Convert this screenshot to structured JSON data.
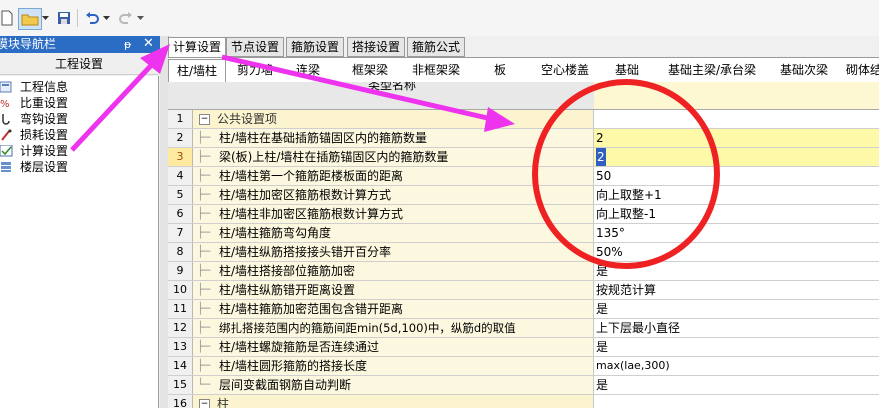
{
  "toolbar": {
    "icons": [
      "new-file-icon",
      "open-folder-icon",
      "dropdown-arrow-icon",
      "save-icon",
      "undo-icon",
      "dropdown-arrow-icon",
      "redo-icon",
      "dropdown-arrow-icon"
    ]
  },
  "nav": {
    "title": "模块导航栏",
    "pin_glyph": "ᵽ",
    "close_glyph": "✕",
    "header": "工程设置",
    "items": [
      {
        "label": "工程信息",
        "icon": "info-icon"
      },
      {
        "label": "比重设置",
        "icon": "ratio-icon"
      },
      {
        "label": "弯钩设置",
        "icon": "hook-icon"
      },
      {
        "label": "损耗设置",
        "icon": "loss-icon"
      },
      {
        "label": "计算设置",
        "icon": "calc-icon"
      },
      {
        "label": "楼层设置",
        "icon": "floor-icon"
      }
    ]
  },
  "tabs": [
    "计算设置",
    "节点设置",
    "箍筋设置",
    "搭接设置",
    "箍筋公式"
  ],
  "subtabs": [
    "柱/墙柱",
    "剪力墙",
    "连梁",
    "框架梁",
    "非框架梁",
    "板",
    "空心楼盖",
    "基础",
    "基础主梁/承台梁",
    "基础次梁",
    "砌体结"
  ],
  "grid": {
    "header_name": "类型名称",
    "rows": [
      {
        "num": "1",
        "name": "公共设置项",
        "value": ""
      },
      {
        "num": "2",
        "name": "柱/墙柱在基础插筋锚固区内的箍筋数量",
        "value": "2"
      },
      {
        "num": "3",
        "name": "梁(板)上柱/墙柱在插筋锚固区内的箍筋数量",
        "value": "2"
      },
      {
        "num": "4",
        "name": "柱/墙柱第一个箍筋距楼板面的距离",
        "value": "50"
      },
      {
        "num": "5",
        "name": "柱/墙柱加密区箍筋根数计算方式",
        "value": "向上取整+1"
      },
      {
        "num": "6",
        "name": "柱/墙柱非加密区箍筋根数计算方式",
        "value": "向上取整-1"
      },
      {
        "num": "7",
        "name": "柱/墙柱箍筋弯勾角度",
        "value": "135°"
      },
      {
        "num": "8",
        "name": "柱/墙柱纵筋搭接接头错开百分率",
        "value": "50%"
      },
      {
        "num": "9",
        "name": "柱/墙柱搭接部位箍筋加密",
        "value": "是"
      },
      {
        "num": "10",
        "name": "柱/墙柱纵筋错开距离设置",
        "value": "按规范计算"
      },
      {
        "num": "11",
        "name": "柱/墙柱箍筋加密范围包含错开距离",
        "value": "是"
      },
      {
        "num": "12",
        "name": "绑扎搭接范围内的箍筋间距min(5d,100)中，纵筋d的取值",
        "value": "上下层最小直径"
      },
      {
        "num": "13",
        "name": "柱/墙柱螺旋箍筋是否连续通过",
        "value": "是"
      },
      {
        "num": "14",
        "name": "柱/墙柱圆形箍筋的搭接长度",
        "value": "max(lae,300)"
      },
      {
        "num": "15",
        "name": "层间变截面钢筋自动判断",
        "value": "是"
      },
      {
        "num": "16",
        "name": "柱",
        "value": ""
      }
    ]
  },
  "colors": {
    "nav_title_bg": "#2b6cc4",
    "arrow": "#ee33ee",
    "circle": "#ee2222",
    "highlight_value": "#fdf9a8",
    "name_column_bg": "#fcf8df"
  }
}
